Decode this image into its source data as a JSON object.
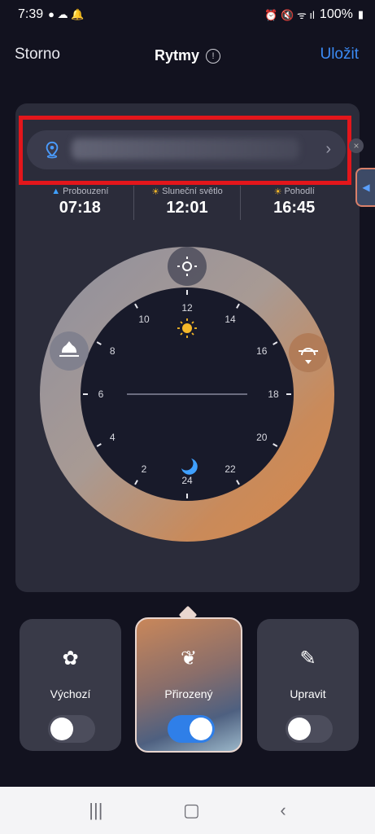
{
  "status": {
    "time": "7:39",
    "battery": "100%"
  },
  "header": {
    "cancel": "Storno",
    "title": "Rytmy",
    "save": "Uložit"
  },
  "times": [
    {
      "label": "Probouzení",
      "value": "07:18",
      "icon": "sunrise-icon"
    },
    {
      "label": "Sluneční světlo",
      "value": "12:01",
      "icon": "sun-icon"
    },
    {
      "label": "Pohodlí",
      "value": "16:45",
      "icon": "sunset-icon"
    }
  ],
  "dial": {
    "hour_labels": [
      "12",
      "14",
      "16",
      "18",
      "20",
      "22",
      "24",
      "2",
      "4",
      "6",
      "8",
      "10"
    ]
  },
  "modes": [
    {
      "label": "Výchozí",
      "icon": "flower-icon",
      "enabled": false
    },
    {
      "label": "Přirozený",
      "icon": "leaf-icon",
      "enabled": true
    },
    {
      "label": "Upravit",
      "icon": "pencil-icon",
      "enabled": false
    }
  ],
  "colors": {
    "accent": "#3b8bf5",
    "highlight": "#e3161b",
    "dial_warm": "#d9884a"
  }
}
